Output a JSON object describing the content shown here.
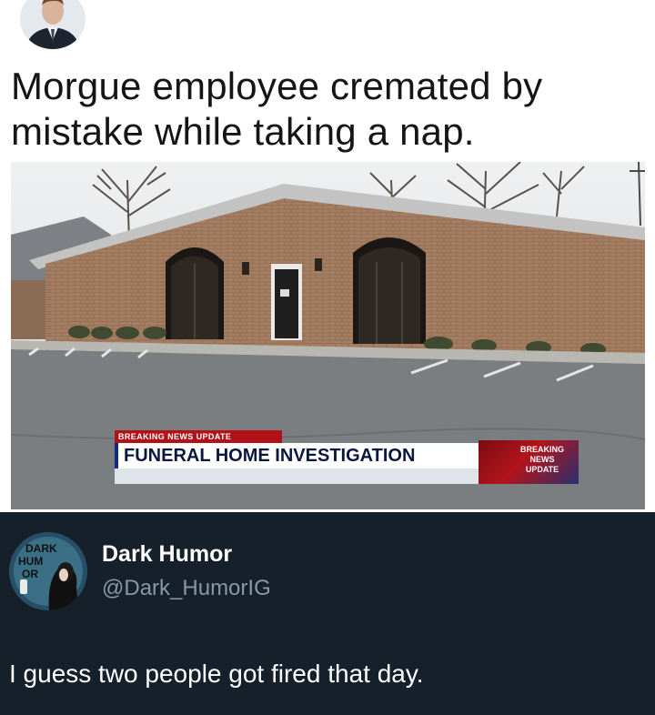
{
  "meme": {
    "headline": "Morgue employee cremated by mistake while taking a nap.",
    "ticker": {
      "label": "BREAKING NEWS UPDATE",
      "headline": "FUNERAL HOME INVESTIGATION",
      "badge_line1": "BREAKING",
      "badge_line2": "NEWS",
      "badge_line3": "UPDATE"
    }
  },
  "post": {
    "author_name": "Dark Humor",
    "author_handle": "@Dark_HumorIG",
    "avatar_text_1": "DARK",
    "avatar_text_2": "HUM",
    "avatar_text_3": "OR",
    "text": "I guess two people got fired that day."
  },
  "colors": {
    "post_background": "#15202b",
    "handle_gray": "#8899a6",
    "ticker_red": "#b01217",
    "ticker_navy": "#0a1840"
  }
}
